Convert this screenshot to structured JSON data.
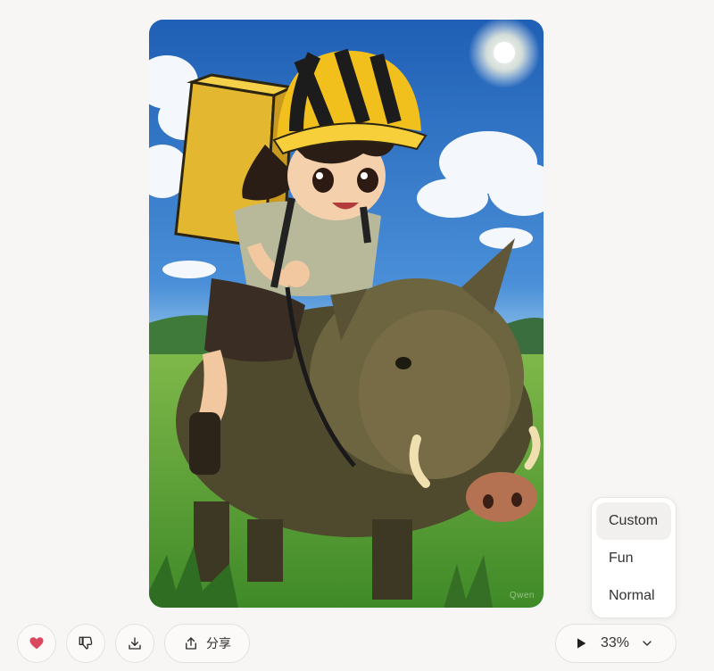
{
  "image": {
    "alt": "Anime girl in yellow-black striped helmet riding a wild boar through a meadow",
    "watermark": "Qwen"
  },
  "actions": {
    "like_icon": "heart-icon",
    "dislike_icon": "thumbs-down-icon",
    "download_icon": "download-icon",
    "share_icon": "share-icon",
    "share_label": "分享"
  },
  "player": {
    "play_icon": "play-icon",
    "progress": "33%",
    "dropdown_icon": "chevron-down-icon"
  },
  "voice_menu": {
    "items": [
      "Custom",
      "Fun",
      "Normal"
    ],
    "selected": "Custom"
  },
  "colors": {
    "like_heart": "#d9485f",
    "background": "#f7f6f4"
  }
}
